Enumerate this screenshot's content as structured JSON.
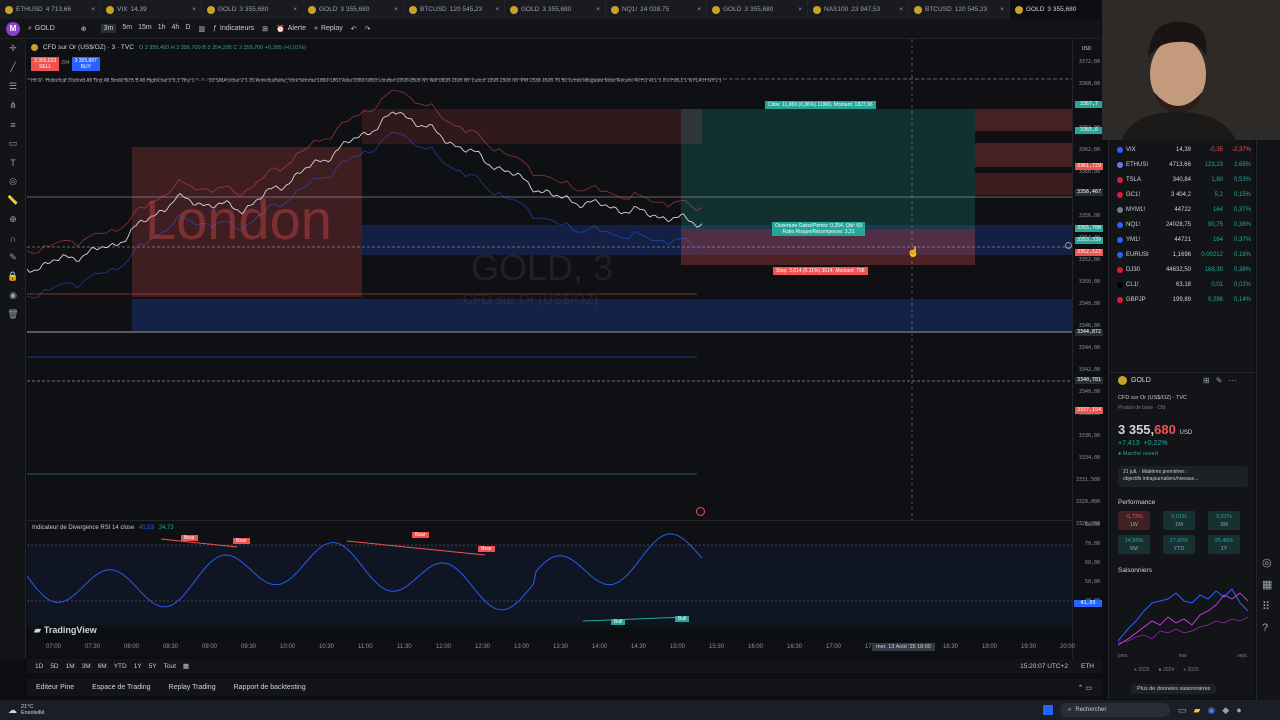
{
  "tabs": [
    {
      "symbol": "ETHUSD",
      "price": "4 713,66"
    },
    {
      "symbol": "VIX",
      "price": "14,39"
    },
    {
      "symbol": "GOLD",
      "price": "3 355,680"
    },
    {
      "symbol": "GOLD",
      "price": "3 355,680"
    },
    {
      "symbol": "BTCUSD",
      "price": "120 545,23"
    },
    {
      "symbol": "GOLD",
      "price": "3 355,680"
    },
    {
      "symbol": "NQ1!",
      "price": "24 028,75"
    },
    {
      "symbol": "GOLD",
      "price": "3 355,680"
    },
    {
      "symbol": "NAS100",
      "price": "23 947,53"
    },
    {
      "symbol": "BTCUSD",
      "price": "120 545,23"
    },
    {
      "symbol": "GOLD",
      "price": "3 355,680"
    }
  ],
  "toolbar": {
    "avatar": "M",
    "symbol": "GOLD",
    "timeframes": [
      "3m",
      "5m",
      "15m",
      "1h",
      "4h",
      "D"
    ],
    "indicators": "Indicateurs",
    "alert": "Alerte",
    "replay": "Replay"
  },
  "chart": {
    "title": "CFD sur Or (US$/OZ) · 3 · TVC",
    "ohlc": "O 3 355,493  H 3 356,700  B 3 354,295  C 3 355,700  +0,385 (+0,01%)",
    "sell_price": "3 355,633",
    "sell_label": "SELL",
    "spread": "294",
    "buy_price": "3 355,887",
    "buy_label": "BUY",
    "indicator_line": "Ht G · Historical Colored All Tiny All Small 50 5 5 All High/Low 3 0,1 Tiny 1 ······· 20 SMA close 2 1 20 America/New_York Normal 1800-1801 Asia 2000-0000 London 0200-0500 NY AM 0930-1100 NY Lunch 1200-1300 NY PM 1330-1600 70 50 Limits Mitigated Most Recent 40 H1 4L1 1 0.0 H0L1 1 NY1A H NY1 1",
    "watermark_session": "London",
    "watermark_symbol": "GOLD, 3",
    "watermark_name": "CFD sur Or (US$/OZ)",
    "target_label": "Cible: 11,969 (0,36%) 11969, Montant: 1827,96",
    "position_label": "Ouverture Gains/Pertes: 0,354, Qté: 69",
    "ratio_label": "Ratio Risque/Récompense: 3,31",
    "stop_label": "Stop: 3,614 (0,11%) 3614, Montant: 798",
    "currency": "USD",
    "price_ticks": [
      "3372,00",
      "3368,00",
      "3366,00",
      "3364,00",
      "3362,00",
      "3360,00",
      "3358,00",
      "3356,00",
      "3354,00",
      "3352,00",
      "3350,00",
      "3348,00",
      "3346,00",
      "3344,00",
      "3342,00",
      "3340,00",
      "3338,00",
      "3336,00",
      "3334,00",
      "3331,500",
      "3329,000",
      "3326,800"
    ],
    "price_tags": [
      {
        "value": "3367,7",
        "color": "#26a69a"
      },
      {
        "value": "3365,6",
        "color": "#26a69a"
      },
      {
        "value": "3361,729",
        "color": "#ef5350"
      },
      {
        "value": "3356,467",
        "color": "#2a2e39"
      },
      {
        "value": "3355,700",
        "color": "#26a69a"
      },
      {
        "value": "3353,339",
        "color": "#26a69a"
      },
      {
        "value": "3352,523",
        "color": "#ef5350"
      },
      {
        "value": "3344,872",
        "color": "#2a2e39"
      },
      {
        "value": "3340,781",
        "color": "#2a2e39"
      },
      {
        "value": "3337,154",
        "color": "#ef5350"
      }
    ]
  },
  "rsi": {
    "title": "Indicateur de Divergence RSI 14 close",
    "value": "41,03",
    "value2": "34,73",
    "levels": [
      "80,00",
      "70,00",
      "60,00",
      "50,00",
      "40,00"
    ],
    "current": "41,03",
    "bear_label": "Bear",
    "bull_label": "Bull"
  },
  "time_ticks": [
    "07:00",
    "07:30",
    "08:00",
    "08:30",
    "09:00",
    "09:30",
    "10:00",
    "10:30",
    "11:00",
    "11:30",
    "12:00",
    "12:30",
    "13:00",
    "13:30",
    "14:00",
    "14:30",
    "15:00",
    "15:30",
    "16:00",
    "16:30",
    "17:00",
    "17:30",
    "18:00",
    "18:30",
    "19:00",
    "19:30",
    "20:00"
  ],
  "crosshair_time": "mer. 13 Août '25   18:00",
  "logo": "TradingView",
  "ranges": [
    "1D",
    "5D",
    "1M",
    "3M",
    "6M",
    "YTD",
    "1Y",
    "5Y",
    "Tout"
  ],
  "clock": "15:20:07 UTC+2",
  "session": "ETH",
  "bottom_tabs": [
    "Editeur Pine",
    "Espace de Trading",
    "Replay Trading",
    "Rapport de backtesting"
  ],
  "watchlist": [
    {
      "symbol": "VIX",
      "last": "14,39",
      "chg": "-0,35",
      "pct": "-2,37%",
      "dir": "down",
      "color": "#2962ff"
    },
    {
      "symbol": "ETHUSI",
      "last": "4713,66",
      "chg": "123,23",
      "pct": "2,68%",
      "dir": "up",
      "color": "#627eea"
    },
    {
      "symbol": "TSLA",
      "last": "340,84",
      "chg": "1,80",
      "pct": "0,53%",
      "dir": "up",
      "color": "#e31937"
    },
    {
      "symbol": "GC1!",
      "last": "3 404,2",
      "chg": "5,2",
      "pct": "0,15%",
      "dir": "up",
      "color": "#e31937"
    },
    {
      "symbol": "MYM1!",
      "last": "44722",
      "chg": "164",
      "pct": "0,37%",
      "dir": "up",
      "color": "#787b86"
    },
    {
      "symbol": "NQ1!",
      "last": "24028,75",
      "chg": "90,75",
      "pct": "0,38%",
      "dir": "up",
      "color": "#2962ff"
    },
    {
      "symbol": "YM1!",
      "last": "44721",
      "chg": "164",
      "pct": "0,37%",
      "dir": "up",
      "color": "#2962ff"
    },
    {
      "symbol": "EURUSI",
      "last": "1,1696",
      "chg": "0,00212",
      "pct": "0,18%",
      "dir": "up",
      "color": "#2962ff"
    },
    {
      "symbol": "DJ30",
      "last": "44632,50",
      "chg": "168,30",
      "pct": "0,38%",
      "dir": "up",
      "color": "#e31937"
    },
    {
      "symbol": "CL1!",
      "last": "63,18",
      "chg": "0,01",
      "pct": "0,02%",
      "dir": "up",
      "color": "#000000"
    },
    {
      "symbol": "GBPJP",
      "last": "199,89",
      "chg": "0,286",
      "pct": "0,14%",
      "dir": "up",
      "color": "#e31937"
    }
  ],
  "details": {
    "symbol": "GOLD",
    "name": "CFD sur Or (US$/OZ) · TVC",
    "type": "Produit de base · Cfd",
    "price_main": "3 355,",
    "price_dec": "680",
    "currency": "USD",
    "change": "+7,413",
    "change_pct": "+0,22%",
    "market_status": "Marché ouvert",
    "news_date": "21 juil. · Matières premières :",
    "news_text": "objectifs intrajournaliers/niveaux...",
    "perf_title": "Performance",
    "perf": [
      {
        "value": "-0,73%",
        "period": "1W",
        "dir": "down"
      },
      {
        "value": "0,01%",
        "period": "1M",
        "dir": "up"
      },
      {
        "value": "5,61%",
        "period": "3M",
        "dir": "up"
      },
      {
        "value": "14,56%",
        "period": "6M",
        "dir": "up"
      },
      {
        "value": "27,90%",
        "period": "YTD",
        "dir": "up"
      },
      {
        "value": "35,45%",
        "period": "1Y",
        "dir": "up"
      }
    ],
    "seasonal_title": "Saisonniers",
    "seasonal_months": [
      "janv.",
      "mai",
      "sept."
    ],
    "seasonal_years": [
      "2025",
      "2024",
      "2023"
    ],
    "more_seasonal": "Plus de données saisonnières"
  },
  "taskbar": {
    "weather": "21°C",
    "weather_desc": "Ensoleillé",
    "search": "Rechercher"
  }
}
